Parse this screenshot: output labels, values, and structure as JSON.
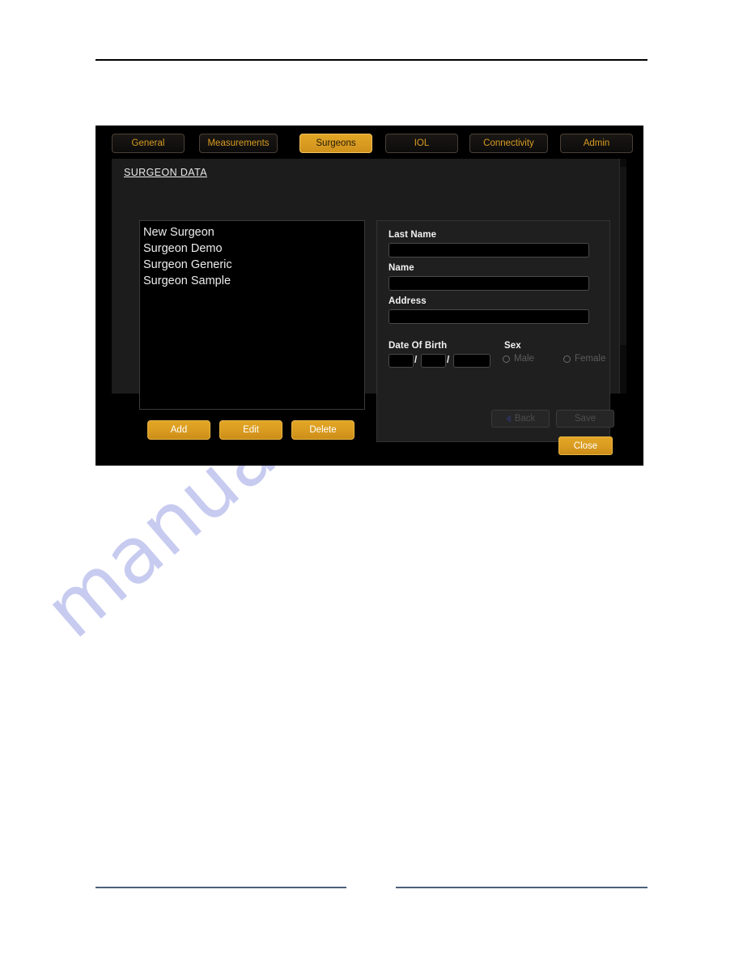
{
  "watermark": {
    "text": "manualshive.com",
    "color": "#c6c9f0"
  },
  "theme": {
    "accent_gold": "#d99b20",
    "tab_text_gold": "#d99b20",
    "panel_bg": "#1c1c1c",
    "dialog_bg": "#000000",
    "footer_rule_color": "#4c6179"
  },
  "dialog": {
    "tabs": [
      {
        "label": "General",
        "active": false
      },
      {
        "label": "Measurements",
        "active": false
      },
      {
        "label": "Surgeons",
        "active": true
      },
      {
        "label": "IOL",
        "active": false
      },
      {
        "label": "Connectivity",
        "active": false
      },
      {
        "label": "Admin",
        "active": false
      }
    ],
    "panel_title": "SURGEON DATA",
    "surgeon_list": [
      "New Surgeon",
      "Surgeon Demo",
      "Surgeon Generic",
      "Surgeon Sample"
    ],
    "list_buttons": {
      "add": "Add",
      "edit": "Edit",
      "delete": "Delete"
    },
    "form": {
      "last_name": {
        "label": "Last Name",
        "value": "",
        "placeholder": ""
      },
      "name": {
        "label": "Name",
        "value": "",
        "placeholder": ""
      },
      "address": {
        "label": "Address",
        "value": "",
        "placeholder": ""
      },
      "date_of_birth": {
        "label": "Date Of Birth",
        "separator": "/",
        "day": "",
        "month": "",
        "year": ""
      },
      "sex": {
        "label": "Sex",
        "options": [
          {
            "label": "Male",
            "selected": false
          },
          {
            "label": "Female",
            "selected": false
          }
        ]
      },
      "back_button": {
        "label": "Back",
        "icon": "back-arrow-icon",
        "disabled": true
      },
      "save_button": {
        "label": "Save",
        "disabled": true
      }
    },
    "close_button": "Close"
  }
}
